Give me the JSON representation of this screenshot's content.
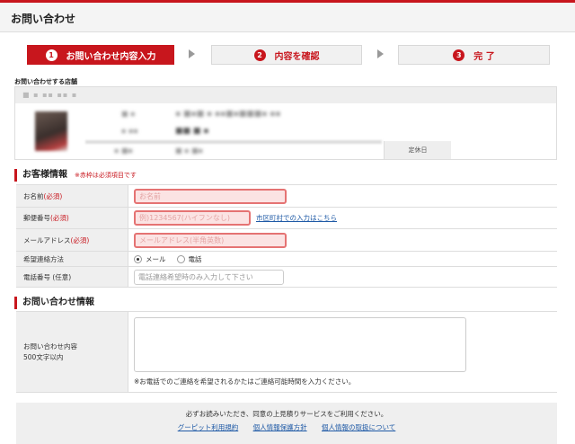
{
  "page": {
    "title": "お問い合わせ"
  },
  "steps": [
    {
      "num": "1",
      "label": "お問い合わせ内容入力"
    },
    {
      "num": "2",
      "label": "内容を確認"
    },
    {
      "num": "3",
      "label": "完 了"
    }
  ],
  "shop": {
    "label": "お問い合わせする店舗",
    "rest_day_label": "定休日"
  },
  "customer": {
    "heading": "お客様情報",
    "note": "※赤枠は必須項目です",
    "name_label": "お名前",
    "name_required": "(必須)",
    "name_placeholder": "お名前",
    "zip_label": "郵便番号",
    "zip_required": "(必須)",
    "zip_placeholder": "例)1234567(ハイフンなし)",
    "zip_link": "市区町村での入力はこちら",
    "email_label": "メールアドレス",
    "email_required": "(必須)",
    "email_placeholder": "メールアドレス(半角英数)",
    "contact_label": "希望連絡方法",
    "contact_options": [
      "メール",
      "電話"
    ],
    "contact_selected": "メール",
    "phone_label": "電話番号 (任意)",
    "phone_placeholder": "電話連絡希望時のみ入力して下さい"
  },
  "inquiry": {
    "heading": "お問い合わせ情報",
    "content_label_line1": "お問い合わせ内容",
    "content_label_line2": "500文字以内",
    "hint": "※お電話でのご連絡を希望されるかたはご連絡可能時間を入力ください。"
  },
  "agreement": {
    "text": "必ずお読みいただき、同意の上見積りサービスをご利用ください。",
    "links": [
      "グーピット利用規約",
      "個人情報保護方針",
      "個人情報の取扱について"
    ]
  },
  "colors": {
    "accent": "#c8161d",
    "link": "#1f5aa6",
    "required_field": "#fbe3e3"
  }
}
